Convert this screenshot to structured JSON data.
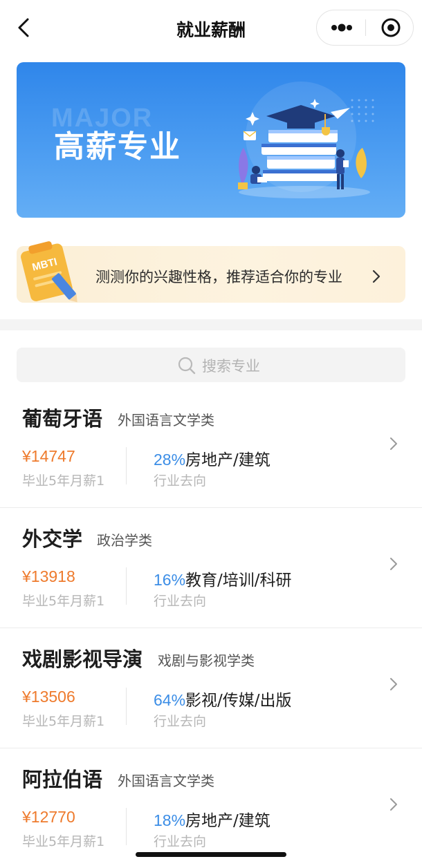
{
  "nav": {
    "title": "就业薪酬"
  },
  "banner": {
    "watermark": "MAJOR",
    "title": "高薪专业"
  },
  "promo": {
    "badge": "MBTI",
    "text": "测测你的兴趣性格，推荐适合你的专业"
  },
  "search": {
    "placeholder": "搜索专业"
  },
  "majors": [
    {
      "name": "葡萄牙语",
      "category": "外国语言文学类",
      "salary": "¥14747",
      "salary_label": "毕业5年月薪1",
      "industry_pct": "28%",
      "industry": "房地产/建筑",
      "industry_label": "行业去向"
    },
    {
      "name": "外交学",
      "category": "政治学类",
      "salary": "¥13918",
      "salary_label": "毕业5年月薪1",
      "industry_pct": "16%",
      "industry": "教育/培训/科研",
      "industry_label": "行业去向"
    },
    {
      "name": "戏剧影视导演",
      "category": "戏剧与影视学类",
      "salary": "¥13506",
      "salary_label": "毕业5年月薪1",
      "industry_pct": "64%",
      "industry": "影视/传媒/出版",
      "industry_label": "行业去向"
    },
    {
      "name": "阿拉伯语",
      "category": "外国语言文学类",
      "salary": "¥12770",
      "salary_label": "毕业5年月薪1",
      "industry_pct": "18%",
      "industry": "房地产/建筑",
      "industry_label": "行业去向"
    }
  ],
  "colors": {
    "accent_blue": "#3b8de6",
    "salary_orange": "#ee7a2c",
    "banner_blue": "#2f86ea",
    "promo_bg": "#fbefd6"
  }
}
